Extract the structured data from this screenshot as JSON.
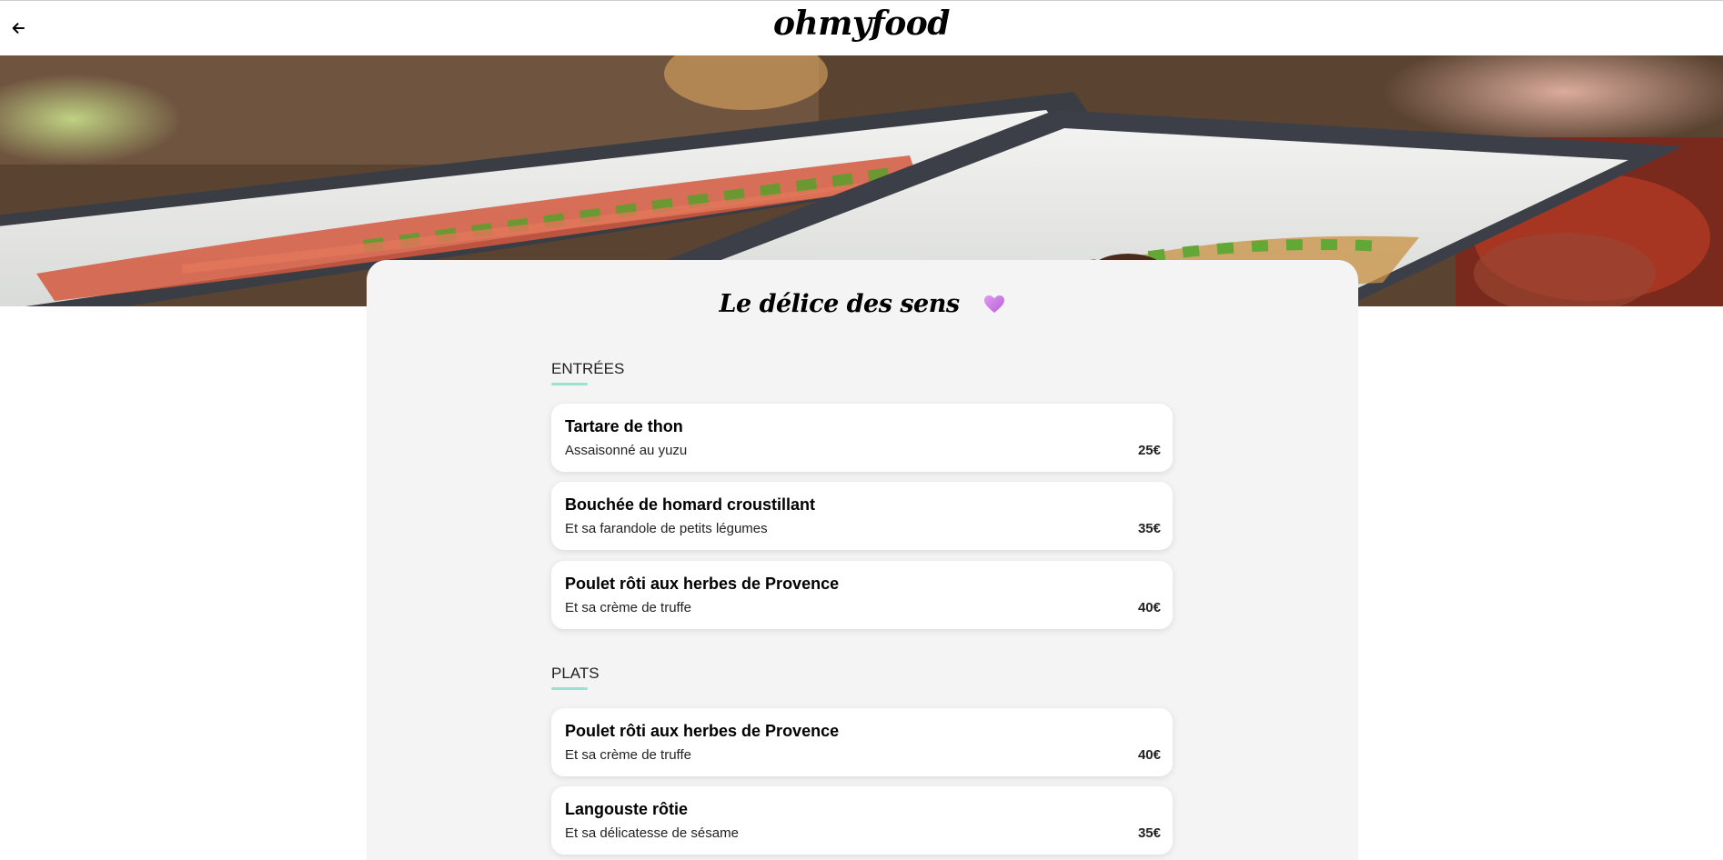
{
  "header": {
    "brand": "ohmyfood"
  },
  "restaurant": {
    "name": "Le délice des sens"
  },
  "menu": {
    "sections": [
      {
        "title": "ENTRÉES",
        "dishes": [
          {
            "name": "Tartare de thon",
            "description": "Assaisonné au yuzu",
            "price": "25€"
          },
          {
            "name": "Bouchée de homard croustillant",
            "description": "Et sa farandole de petits légumes",
            "price": "35€"
          },
          {
            "name": "Poulet rôti aux herbes de Provence",
            "description": "Et sa crème de truffe",
            "price": "40€"
          }
        ]
      },
      {
        "title": "PLATS",
        "dishes": [
          {
            "name": "Poulet rôti aux herbes de Provence",
            "description": "Et sa crème de truffe",
            "price": "40€"
          },
          {
            "name": "Langouste rôtie",
            "description": "Et sa délicatesse de sésame",
            "price": "35€"
          }
        ]
      }
    ]
  },
  "colors": {
    "accent": "#99e2d0",
    "heart": "#d67fe8",
    "card_bg": "#f4f4f4"
  },
  "icons": {
    "back": "arrow-left-icon",
    "favorite": "heart-icon"
  }
}
